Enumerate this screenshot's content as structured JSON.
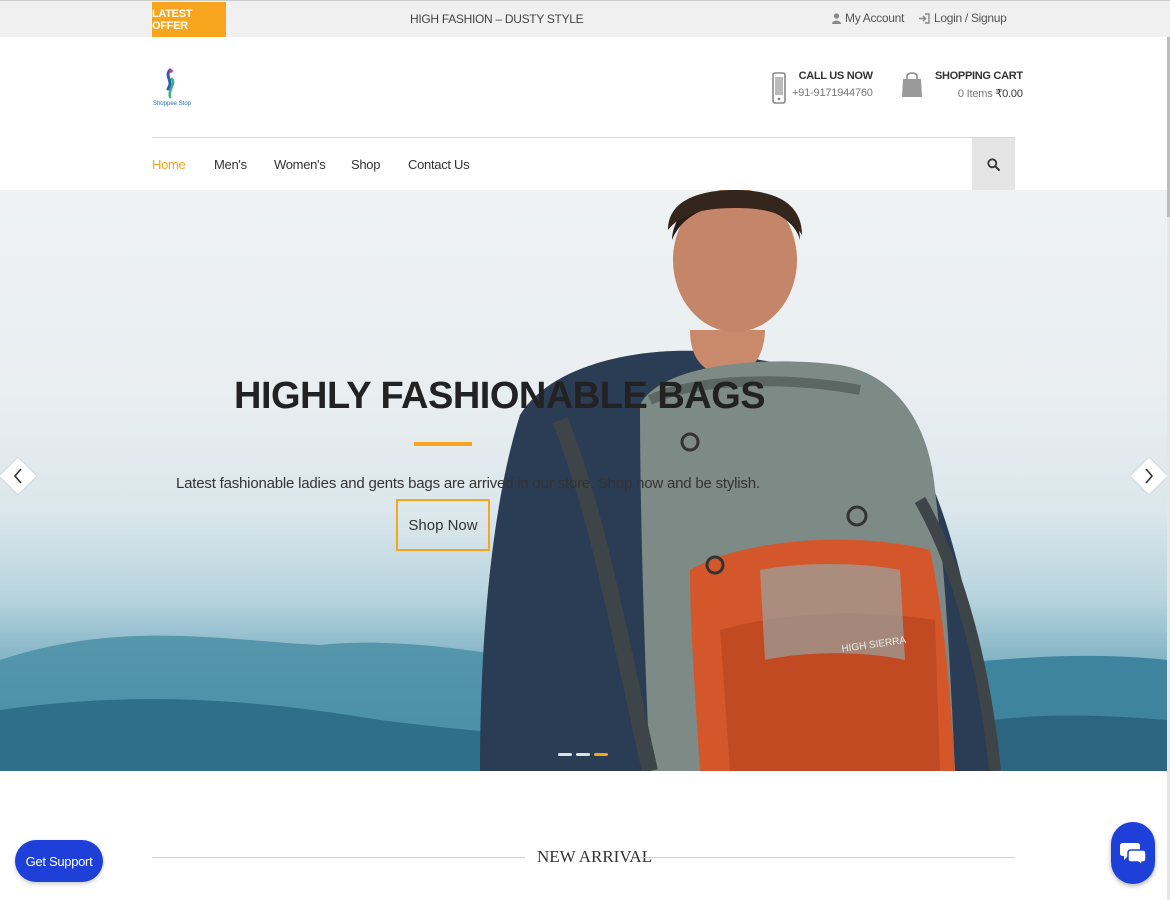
{
  "topbar": {
    "offer_label": "LATEST OFFER",
    "tagline": "HIGH FASHION – DUSTY STYLE",
    "my_account": "My Account",
    "login_signup": "Login / Signup"
  },
  "header": {
    "logo_text": "Shoppee Stop",
    "call": {
      "title": "CALL US NOW",
      "phone": "+91-9171944760"
    },
    "cart": {
      "title": "SHOPPING CART",
      "items": "0 Items",
      "total": "₹0.00"
    }
  },
  "nav": {
    "items": [
      {
        "label": "Home",
        "active": true
      },
      {
        "label": "Men's",
        "active": false
      },
      {
        "label": "Women's",
        "active": false
      },
      {
        "label": "Shop",
        "active": false
      },
      {
        "label": "Contact Us",
        "active": false
      }
    ],
    "search_icon": "search-icon"
  },
  "hero": {
    "title": "HIGHLY FASHIONABLE BAGS",
    "description": "Latest fashionable ladies and gents bags are arrived in our store. Shop now and be stylish.",
    "button": "Shop Now",
    "slides": 3,
    "active_slide": 3,
    "backpack_brand": "HIGH SIERRA"
  },
  "section": {
    "title": "NEW ARRIVAL"
  },
  "support": {
    "label": "Get Support"
  },
  "colors": {
    "accent": "#f7a51d",
    "support_blue": "#1e40d8",
    "topbar_bg": "#f0f0f0"
  }
}
